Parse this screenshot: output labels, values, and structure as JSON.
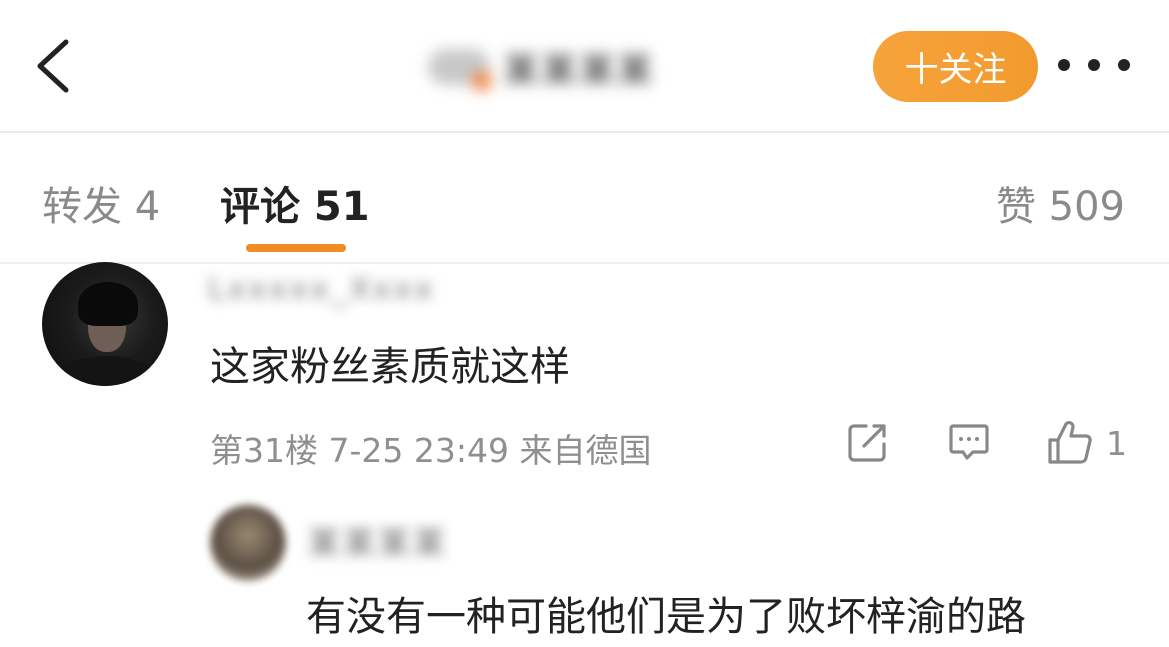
{
  "header": {
    "back_icon": "chevron-left-icon",
    "title_blurred": "某某某某",
    "follow_label": "十关注",
    "more_icon": "more-dots-icon",
    "accent_color": "#f29a2e"
  },
  "tabs": {
    "repost": "转发 4",
    "comments": "评论 51",
    "likes": "赞 509",
    "active": "comments"
  },
  "comment": {
    "username_blurred": "Lxxxxx_Xxxx",
    "text": "这家粉丝素质就这样",
    "meta": "第31楼 7-25 23:49 来自德国",
    "like_count": "1",
    "icons": [
      "share-icon",
      "comment-icon",
      "thumbs-up-icon"
    ]
  },
  "reply": {
    "username_blurred": "某某某某",
    "text": "有没有一种可能他们是为了败坏梓渝的路"
  }
}
